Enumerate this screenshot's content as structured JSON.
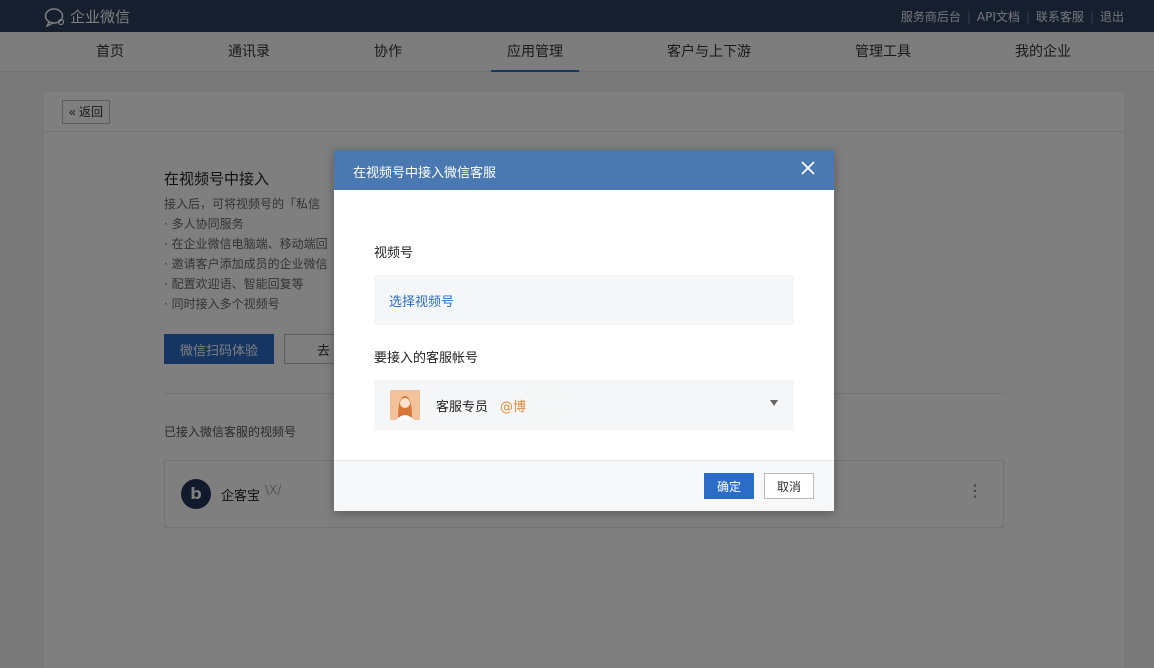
{
  "app": {
    "logo_text": "企业微信",
    "top_links": [
      "服务商后台",
      "API文档",
      "联系客服",
      "退出"
    ]
  },
  "nav": {
    "items": [
      "首页",
      "通讯录",
      "协作",
      "应用管理",
      "客户与上下游",
      "管理工具",
      "我的企业"
    ],
    "active": "应用管理"
  },
  "page": {
    "back_label": "返回",
    "section_title": "在视频号中接入",
    "desc_lines": [
      "接入后，可将视频号的「私信",
      "· 多人协同服务",
      "· 在企业微信电脑端、移动端回",
      "· 邀请客户添加成员的企业微信",
      "· 配置欢迎语、智能回复等",
      "· 同时接入多个视频号"
    ],
    "scan_button": "微信扫码体验",
    "go_button": "去",
    "linked_title": "已接入微信客服的视频号",
    "card": {
      "logo_letter": "b",
      "name": "企客宝",
      "tag": "\\X/"
    }
  },
  "dialog": {
    "title": "在视频号中接入微信客服",
    "video_label": "视频号",
    "select_video": "选择视频号",
    "account_label": "要接入的客服帐号",
    "agent_name": "客服专员",
    "agent_corp": "@博",
    "ok_button": "确定",
    "cancel_button": "取消"
  },
  "colors": {
    "topbar": "#2c3e5a",
    "accent": "#2a6cc6",
    "dialog_header": "#4a78b0",
    "corp_tag": "#e08a3a"
  }
}
